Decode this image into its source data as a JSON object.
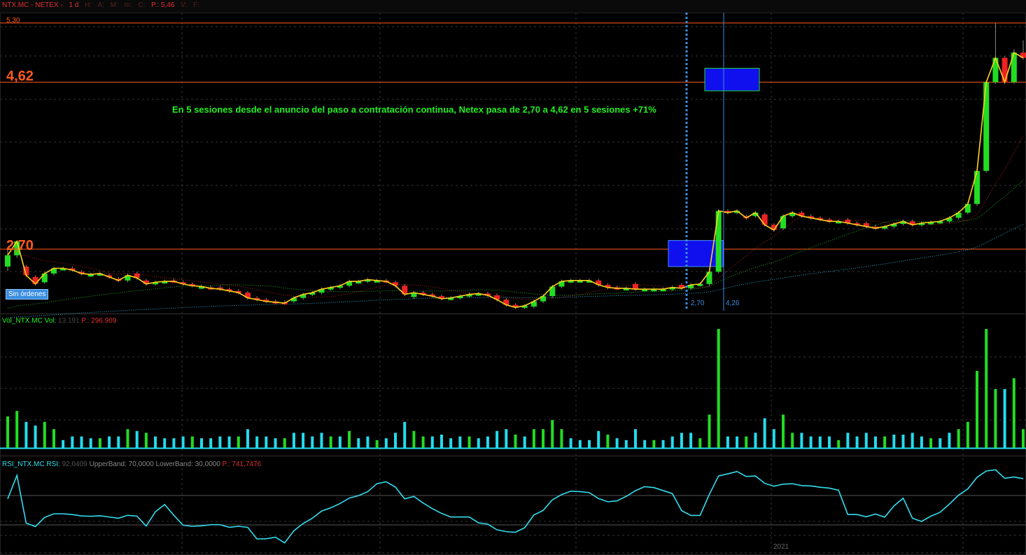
{
  "header": {
    "symbol": "NTX.MC - NETEX -",
    "interval": "1 d",
    "fields": [
      "H:",
      "A:",
      "M:",
      "m:",
      "C:"
    ],
    "last_price": "P.: 5,46",
    "fields2": [
      "V:",
      "F:"
    ]
  },
  "price_panel": {
    "top_level_label": "5,30",
    "resistance_label": "4,62",
    "support_label": "2,70",
    "annotation": "En 5 sesiones desde el anuncio del paso a contratación continua, Netex pasa de 2,70 a 4,62 en 5 sesiones +71%",
    "button_label": "Sin órdenes",
    "marker_left_label": "2,70",
    "marker_right_label": "4,26"
  },
  "volume_panel": {
    "name": "Vol_NTX.MC",
    "field": "Vol:",
    "value": "13.191",
    "p_label": "P.: 296.909"
  },
  "rsi_panel": {
    "name": "RSI_NTX.MC",
    "field": "RSI:",
    "value": "92,0409",
    "upper": "UpperBand: 70,0000",
    "lower": "LowerBand: 30,0000",
    "p_label": "P.: 741,7476",
    "year_label": "2021"
  },
  "colors": {
    "up": "#22dd22",
    "down": "#ee2222",
    "close_line": "#ffd21e",
    "level_line": "#ff5a1e",
    "volume_up": "#22dd22",
    "volume_other": "#22ddee",
    "rsi": "#33ddee",
    "rsi_high": "#22ee22",
    "rsi_low": "#ee3333",
    "highlight": "#1010ee"
  },
  "chart_data": {
    "type": "candlestick",
    "levels": [
      5.3,
      4.62,
      2.7
    ],
    "ylim": [
      1.96,
      5.42
    ],
    "candles": [
      [
        2.5,
        2.63,
        2.45,
        2.7
      ],
      [
        2.63,
        2.79,
        2.6,
        2.8
      ],
      [
        2.5,
        2.4,
        2.38,
        2.52
      ],
      [
        2.38,
        2.3,
        2.28,
        2.4
      ],
      [
        2.32,
        2.42,
        2.3,
        2.44
      ],
      [
        2.42,
        2.48,
        2.4,
        2.5
      ],
      [
        2.48,
        2.48,
        2.46,
        2.5
      ],
      [
        2.48,
        2.46,
        2.44,
        2.5
      ],
      [
        2.44,
        2.42,
        2.4,
        2.46
      ],
      [
        2.4,
        2.41,
        2.38,
        2.43
      ],
      [
        2.41,
        2.42,
        2.39,
        2.44
      ],
      [
        2.4,
        2.38,
        2.36,
        2.42
      ],
      [
        2.36,
        2.34,
        2.32,
        2.38
      ],
      [
        2.34,
        2.4,
        2.32,
        2.42
      ],
      [
        2.42,
        2.37,
        2.35,
        2.44
      ],
      [
        2.34,
        2.3,
        2.28,
        2.36
      ],
      [
        2.3,
        2.32,
        2.28,
        2.34
      ],
      [
        2.32,
        2.33,
        2.3,
        2.35
      ],
      [
        2.34,
        2.33,
        2.31,
        2.36
      ],
      [
        2.32,
        2.3,
        2.28,
        2.34
      ],
      [
        2.3,
        2.28,
        2.26,
        2.32
      ],
      [
        2.26,
        2.27,
        2.24,
        2.29
      ],
      [
        2.26,
        2.25,
        2.23,
        2.28
      ],
      [
        2.26,
        2.24,
        2.22,
        2.28
      ],
      [
        2.24,
        2.22,
        2.2,
        2.26
      ],
      [
        2.22,
        2.2,
        2.18,
        2.24
      ],
      [
        2.2,
        2.14,
        2.12,
        2.22
      ],
      [
        2.14,
        2.12,
        2.1,
        2.16
      ],
      [
        2.12,
        2.1,
        2.08,
        2.14
      ],
      [
        2.1,
        2.09,
        2.07,
        2.12
      ],
      [
        2.09,
        2.08,
        2.06,
        2.11
      ],
      [
        2.1,
        2.14,
        2.08,
        2.16
      ],
      [
        2.14,
        2.18,
        2.12,
        2.2
      ],
      [
        2.18,
        2.2,
        2.16,
        2.22
      ],
      [
        2.2,
        2.24,
        2.18,
        2.26
      ],
      [
        2.24,
        2.26,
        2.22,
        2.28
      ],
      [
        2.26,
        2.28,
        2.24,
        2.3
      ],
      [
        2.28,
        2.33,
        2.26,
        2.35
      ],
      [
        2.32,
        2.33,
        2.3,
        2.35
      ],
      [
        2.33,
        2.35,
        2.31,
        2.37
      ],
      [
        2.34,
        2.34,
        2.32,
        2.36
      ],
      [
        2.34,
        2.33,
        2.31,
        2.36
      ],
      [
        2.32,
        2.28,
        2.26,
        2.34
      ],
      [
        2.28,
        2.18,
        2.16,
        2.3
      ],
      [
        2.15,
        2.2,
        2.13,
        2.22
      ],
      [
        2.2,
        2.18,
        2.16,
        2.22
      ],
      [
        2.18,
        2.16,
        2.14,
        2.2
      ],
      [
        2.16,
        2.13,
        2.11,
        2.18
      ],
      [
        2.13,
        2.14,
        2.11,
        2.16
      ],
      [
        2.14,
        2.16,
        2.12,
        2.18
      ],
      [
        2.16,
        2.18,
        2.14,
        2.2
      ],
      [
        2.18,
        2.19,
        2.16,
        2.21
      ],
      [
        2.19,
        2.17,
        2.15,
        2.21
      ],
      [
        2.17,
        2.12,
        2.1,
        2.19
      ],
      [
        2.12,
        2.06,
        2.04,
        2.14
      ],
      [
        2.06,
        2.03,
        2.01,
        2.08
      ],
      [
        2.03,
        2.05,
        2.01,
        2.07
      ],
      [
        2.04,
        2.1,
        2.02,
        2.12
      ],
      [
        2.1,
        2.16,
        2.08,
        2.18
      ],
      [
        2.16,
        2.27,
        2.14,
        2.29
      ],
      [
        2.27,
        2.33,
        2.25,
        2.35
      ],
      [
        2.33,
        2.34,
        2.31,
        2.36
      ],
      [
        2.34,
        2.34,
        2.32,
        2.36
      ],
      [
        2.34,
        2.34,
        2.32,
        2.36
      ],
      [
        2.34,
        2.29,
        2.27,
        2.36
      ],
      [
        2.29,
        2.26,
        2.24,
        2.31
      ],
      [
        2.26,
        2.25,
        2.23,
        2.28
      ],
      [
        2.25,
        2.25,
        2.23,
        2.27
      ],
      [
        2.3,
        2.24,
        2.22,
        2.32
      ],
      [
        2.24,
        2.24,
        2.22,
        2.26
      ],
      [
        2.24,
        2.24,
        2.22,
        2.26
      ],
      [
        2.24,
        2.24,
        2.22,
        2.26
      ],
      [
        2.24,
        2.26,
        2.22,
        2.28
      ],
      [
        2.29,
        2.25,
        2.23,
        2.31
      ],
      [
        2.25,
        2.29,
        2.23,
        2.31
      ],
      [
        2.29,
        2.3,
        2.27,
        2.32
      ],
      [
        2.3,
        2.44,
        2.28,
        2.46
      ],
      [
        2.44,
        3.14,
        2.42,
        3.16
      ],
      [
        3.14,
        3.12,
        3.1,
        3.16
      ],
      [
        3.12,
        3.14,
        3.1,
        3.16
      ],
      [
        3.08,
        3.06,
        3.04,
        3.1
      ],
      [
        3.08,
        3.12,
        3.06,
        3.14
      ],
      [
        3.1,
        2.98,
        2.96,
        3.12
      ],
      [
        2.98,
        2.92,
        2.9,
        3.0
      ],
      [
        2.94,
        3.08,
        2.92,
        3.1
      ],
      [
        3.08,
        3.12,
        3.06,
        3.14
      ],
      [
        3.12,
        3.08,
        3.06,
        3.14
      ],
      [
        3.08,
        3.06,
        3.04,
        3.1
      ],
      [
        3.06,
        3.04,
        3.02,
        3.08
      ],
      [
        3.04,
        3.02,
        3.0,
        3.06
      ],
      [
        3.02,
        3.02,
        3.0,
        3.04
      ],
      [
        3.04,
        3.0,
        2.98,
        3.06
      ],
      [
        3.0,
        2.98,
        2.96,
        3.02
      ],
      [
        3.0,
        2.96,
        2.94,
        3.02
      ],
      [
        2.96,
        2.94,
        2.92,
        2.98
      ],
      [
        2.94,
        2.96,
        2.92,
        2.98
      ],
      [
        2.96,
        2.99,
        2.94,
        3.01
      ],
      [
        2.99,
        3.02,
        2.97,
        3.04
      ],
      [
        3.02,
        2.98,
        2.96,
        3.04
      ],
      [
        2.98,
        3.0,
        2.96,
        3.02
      ],
      [
        3.0,
        3.01,
        2.98,
        3.03
      ],
      [
        3.01,
        3.02,
        2.99,
        3.04
      ],
      [
        3.02,
        3.06,
        3.0,
        3.08
      ],
      [
        3.06,
        3.12,
        3.04,
        3.14
      ],
      [
        3.12,
        3.22,
        3.1,
        3.24
      ],
      [
        3.22,
        3.6,
        3.2,
        3.62
      ],
      [
        3.6,
        4.62,
        3.58,
        4.64
      ],
      [
        4.62,
        4.9,
        4.6,
        5.3
      ],
      [
        4.9,
        4.62,
        4.6,
        4.92
      ],
      [
        4.62,
        4.96,
        4.6,
        5.0
      ],
      [
        4.96,
        4.9,
        4.88,
        5.1
      ]
    ]
  }
}
